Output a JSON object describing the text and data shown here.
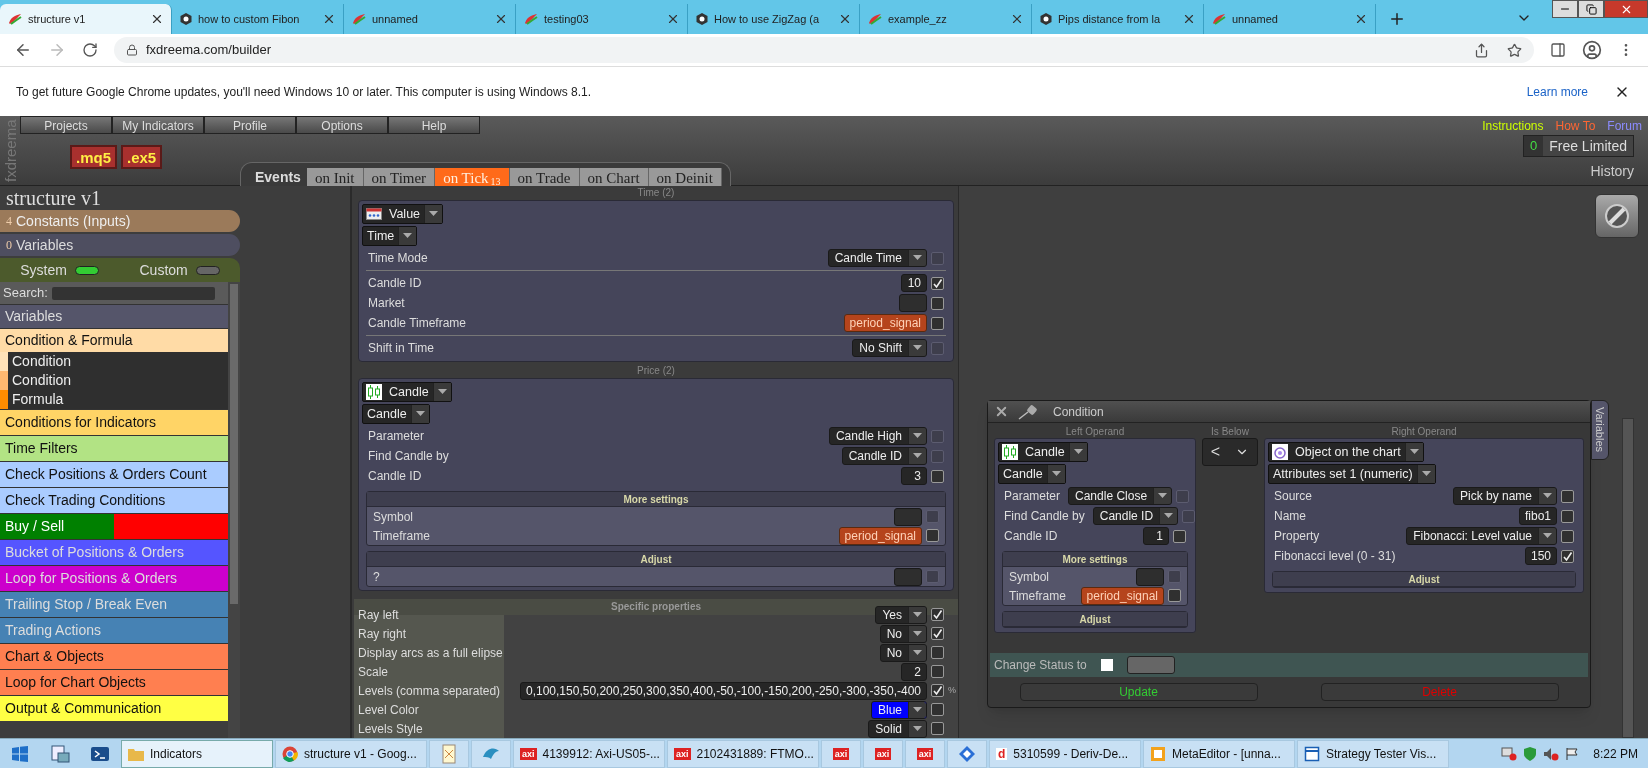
{
  "browser": {
    "tabs": [
      {
        "title": "structure v1",
        "kind": "swirl",
        "selected": true
      },
      {
        "title": "how to custom Fibon",
        "kind": "hexagon",
        "selected": false
      },
      {
        "title": "unnamed",
        "kind": "swirl",
        "selected": false
      },
      {
        "title": "testing03",
        "kind": "swirl",
        "selected": false
      },
      {
        "title": "How to use ZigZag (a",
        "kind": "hexagon",
        "selected": false
      },
      {
        "title": "example_zz",
        "kind": "swirl",
        "selected": false
      },
      {
        "title": "Pips distance from la",
        "kind": "hexagon",
        "selected": false
      },
      {
        "title": "unnamed",
        "kind": "swirl",
        "selected": false
      }
    ],
    "url": "fxdreema.com/builder",
    "infobar": {
      "message": "To get future Google Chrome updates, you'll need Windows 10 or later. This computer is using Windows 8.1.",
      "link": "Learn more"
    }
  },
  "app": {
    "logo": "fxdreema",
    "menu": [
      "Projects",
      "My Indicators",
      "Profile",
      "Options",
      "Help"
    ],
    "links": [
      {
        "label": "Instructions",
        "color": "#ccff00"
      },
      {
        "label": "How To",
        "color": "#ff6633"
      },
      {
        "label": "Forum",
        "color": "#8c8cff"
      }
    ],
    "exports": [
      ".mq5",
      ".ex5"
    ],
    "events_label": "Events",
    "event_tabs": [
      {
        "label": "on Init",
        "selected": false
      },
      {
        "label": "on Timer",
        "selected": false
      },
      {
        "label": "on Tick",
        "badge": "13",
        "selected": true
      },
      {
        "label": "on Trade",
        "selected": false
      },
      {
        "label": "on Chart",
        "selected": false
      },
      {
        "label": "on Deinit",
        "selected": false
      }
    ],
    "account": {
      "count": "0",
      "plan": "Free Limited"
    },
    "history": "History"
  },
  "sidebar": {
    "project": "structure v1",
    "constants": {
      "count": "4",
      "label": "Constants (Inputs)"
    },
    "variables": {
      "count": "0",
      "label": "Variables"
    },
    "toggles": [
      {
        "label": "System",
        "on": true
      },
      {
        "label": "Custom",
        "on": false
      }
    ],
    "search_label": "Search:",
    "items": [
      {
        "label": "Variables",
        "color": "#55556a"
      },
      {
        "label": "Condition & Formula",
        "color": "#ffdba6",
        "expanded": true,
        "children": [
          {
            "label": "Condition",
            "color": "#ffe2b8"
          },
          {
            "label": "Condition",
            "color": "#ffb870"
          },
          {
            "label": "Formula",
            "color": "#ff8c00"
          }
        ]
      },
      {
        "label": "Conditions for Indicators",
        "color": "#ffd466"
      },
      {
        "label": "Time Filters",
        "color": "#b2e384"
      },
      {
        "label": "Check Positions & Orders Count",
        "color": "#aaccff"
      },
      {
        "label": "Check Trading Conditions",
        "color": "#aaccff"
      },
      {
        "label": "Buy / Sell",
        "color": "#008000",
        "swatch": {
          "color": "#ff0000"
        }
      },
      {
        "label": "Bucket of Positions & Orders",
        "color": "#5555ff"
      },
      {
        "label": "Loop for Positions & Orders",
        "color": "#cc00cc"
      },
      {
        "label": "Trailing Stop / Break Even",
        "color": "#4682b4"
      },
      {
        "label": "Trading Actions",
        "color": "#4682b4"
      },
      {
        "label": "Chart & Objects",
        "color": "#ff7f50"
      },
      {
        "label": "Loop for Chart Objects",
        "color": "#ff7f50"
      },
      {
        "label": "Output & Communication",
        "color": "#ffff44"
      }
    ]
  },
  "editor": {
    "time": {
      "title": "Time (2)",
      "selectors": [
        {
          "label": "Value",
          "kind": "value"
        },
        {
          "label": "Time"
        }
      ],
      "rows": [
        {
          "kind": "select",
          "label": "Time Mode",
          "value": "Candle Time",
          "checked": false,
          "disabled": true
        },
        {
          "kind": "divider"
        },
        {
          "kind": "input",
          "label": "Candle ID",
          "value": "10",
          "checked": true,
          "disabled": false
        },
        {
          "kind": "blank",
          "label": "Market",
          "checked": false,
          "disabled": false
        },
        {
          "kind": "variable",
          "label": "Candle Timeframe",
          "value": "period_signal",
          "checked": false,
          "disabled": false
        },
        {
          "kind": "divider"
        },
        {
          "kind": "select",
          "label": "Shift in Time",
          "value": "No Shift",
          "checked": false,
          "disabled": true
        }
      ]
    },
    "price": {
      "title": "Price (2)",
      "selectors": [
        {
          "label": "Candle",
          "kind": "candle"
        },
        {
          "label": "Candle"
        }
      ],
      "rows": [
        {
          "kind": "select",
          "label": "Parameter",
          "value": "Candle High",
          "checked": false,
          "disabled": true
        },
        {
          "kind": "select",
          "label": "Find Candle by",
          "value": "Candle ID",
          "checked": false,
          "disabled": true
        },
        {
          "kind": "input",
          "label": "Candle ID",
          "value": "3",
          "checked": false,
          "disabled": false
        }
      ],
      "groups": [
        {
          "title": "More settings",
          "rows": [
            {
              "kind": "blank",
              "label": "Symbol",
              "checked": false,
              "disabled": true
            },
            {
              "kind": "variable",
              "label": "Timeframe",
              "value": "period_signal",
              "checked": false,
              "disabled": false
            }
          ]
        },
        {
          "title": "Adjust",
          "rows": [
            {
              "kind": "blank",
              "label": "?",
              "checked": false,
              "disabled": true
            }
          ]
        }
      ]
    },
    "specific": {
      "title": "Specific properties",
      "rows": [
        {
          "kind": "select",
          "label": "Ray left",
          "value": "Yes",
          "checked": true,
          "disabled": false
        },
        {
          "kind": "select",
          "label": "Ray right",
          "value": "No",
          "checked": true,
          "disabled": false
        },
        {
          "kind": "select",
          "label": "Display arcs as a full elipse",
          "value": "No",
          "checked": false,
          "disabled": false
        },
        {
          "kind": "input",
          "label": "Scale",
          "value": "2",
          "checked": false,
          "disabled": false
        },
        {
          "kind": "input",
          "label": "Levels (comma separated)",
          "value": "0,100,150,50,200,250,300,350,400,-50,-100,-150,200,-250,-300,-350,-400",
          "checked": true,
          "disabled": false,
          "suffix": "%"
        },
        {
          "kind": "select",
          "label": "Level Color",
          "value": "Blue",
          "color": "#0000ff",
          "checked": false,
          "disabled": false
        },
        {
          "kind": "select",
          "label": "Levels Style",
          "value": "Solid",
          "checked": false,
          "disabled": false
        }
      ]
    }
  },
  "dialog": {
    "title": "Condition",
    "side_tab": "Variables",
    "left": {
      "title": "Left Operand",
      "selectors": [
        {
          "label": "Candle",
          "kind": "candle"
        },
        {
          "label": "Candle"
        }
      ],
      "rows": [
        {
          "kind": "select",
          "label": "Parameter",
          "value": "Candle Close",
          "checked": false,
          "disabled": true
        },
        {
          "kind": "select",
          "label": "Find Candle by",
          "value": "Candle ID",
          "checked": false,
          "disabled": true
        },
        {
          "kind": "input",
          "label": "Candle ID",
          "value": "1",
          "checked": false,
          "disabled": false
        }
      ],
      "groups": [
        {
          "title": "More settings",
          "rows": [
            {
              "kind": "blank",
              "label": "Symbol",
              "checked": false,
              "disabled": true
            },
            {
              "kind": "variable",
              "label": "Timeframe",
              "value": "period_signal",
              "checked": false,
              "disabled": false
            }
          ]
        },
        {
          "title": "Adjust"
        }
      ]
    },
    "operator": {
      "title": "Is Below",
      "value": "<"
    },
    "right": {
      "title": "Right Operand",
      "selectors": [
        {
          "label": "Object on the chart",
          "kind": "object"
        },
        {
          "label": "Attributes set 1 (numeric)"
        }
      ],
      "rows": [
        {
          "kind": "select",
          "label": "Source",
          "value": "Pick by name",
          "checked": false,
          "disabled": false
        },
        {
          "kind": "input",
          "label": "Name",
          "value": "fibo1",
          "checked": false,
          "disabled": false
        },
        {
          "kind": "select",
          "label": "Property",
          "value": "Fibonacci: Level value",
          "checked": false,
          "disabled": false
        },
        {
          "kind": "input",
          "label": "Fibonacci level (0 - 31)",
          "value": "150",
          "checked": true,
          "disabled": false
        }
      ],
      "groups": [
        {
          "title": "Adjust"
        }
      ]
    },
    "status": {
      "label": "Change Status to",
      "checked": false
    },
    "buttons": [
      {
        "label": "Update",
        "kind": "confirm"
      },
      {
        "label": "Delete",
        "kind": "danger"
      }
    ]
  },
  "taskbar": {
    "items": [
      {
        "kind": "start"
      },
      {
        "kind": "explorer"
      },
      {
        "kind": "terminal"
      },
      {
        "kind": "folder",
        "label": "Indicators",
        "selected": true
      },
      {
        "kind": "chrome",
        "label": "structure v1 - Goog...",
        "selected": false
      },
      {
        "kind": "pad",
        "selected": false
      },
      {
        "kind": "bird",
        "selected": false
      },
      {
        "kind": "axi",
        "badge": "axi",
        "label": "4139912: Axi-US05-...",
        "selected": false
      },
      {
        "kind": "axi",
        "badge": "axi",
        "label": "2102431889: FTMO...",
        "selected": false
      },
      {
        "kind": "axi",
        "badge": "axi",
        "selected": false
      },
      {
        "kind": "axi",
        "badge": "axi",
        "selected": false
      },
      {
        "kind": "axi",
        "badge": "axi",
        "selected": false
      },
      {
        "kind": "diamond",
        "selected": false
      },
      {
        "kind": "deriv",
        "badge": "d",
        "label": "5310599 - Deriv-De...",
        "selected": false
      },
      {
        "kind": "meta",
        "label": "MetaEditor - [unna...",
        "selected": false
      },
      {
        "kind": "tester",
        "label": "Strategy Tester Vis...",
        "selected": false
      }
    ],
    "clock": "8:22 PM"
  }
}
